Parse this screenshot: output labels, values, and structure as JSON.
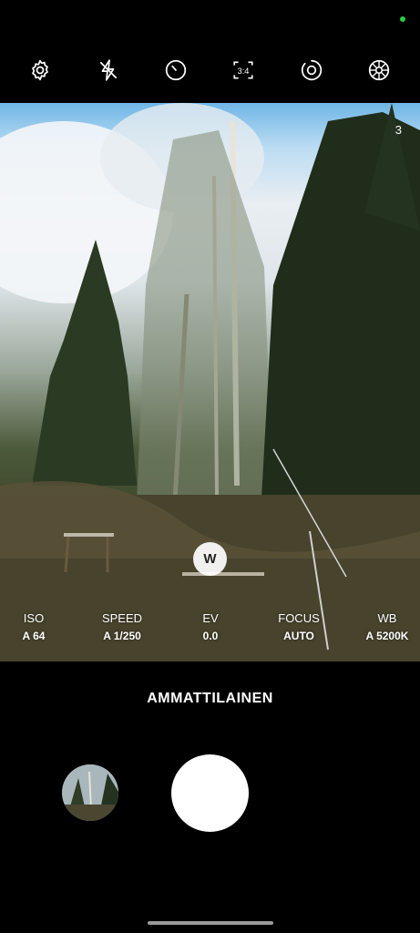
{
  "status": {
    "indicator_color": "#2ecc40"
  },
  "toolbar": {
    "icons": [
      "settings-icon",
      "flash-off-icon",
      "timer-icon",
      "ratio-icon",
      "motion-photo-icon",
      "filter-icon"
    ],
    "ratio_label": "3:4"
  },
  "viewfinder": {
    "counter": "3"
  },
  "zoom": {
    "label": "W"
  },
  "params": [
    {
      "label": "ISO",
      "value": "A 64"
    },
    {
      "label": "SPEED",
      "value": "A 1/250"
    },
    {
      "label": "EV",
      "value": "0.0"
    },
    {
      "label": "FOCUS",
      "value": "AUTO"
    },
    {
      "label": "WB",
      "value": "A 5200K"
    }
  ],
  "mode": {
    "label": "AMMATTILAINEN"
  }
}
